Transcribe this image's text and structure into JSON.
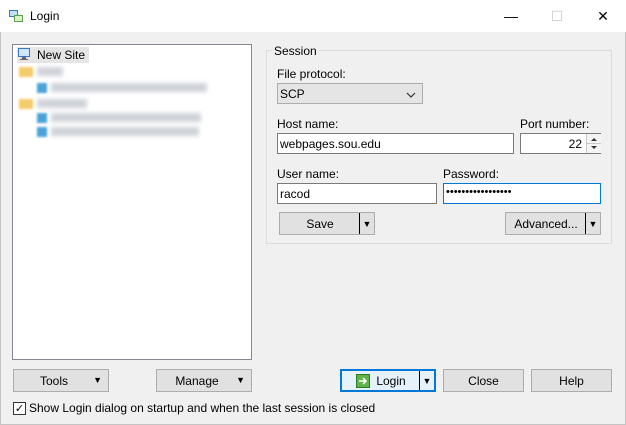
{
  "window": {
    "title": "Login",
    "minimize_glyph": "—",
    "maximize_glyph": "☐",
    "close_glyph": "✕"
  },
  "site_tree": {
    "selected_item": "New Site"
  },
  "session": {
    "group_title": "Session",
    "file_protocol_label": "File protocol:",
    "file_protocol_value": "SCP",
    "host_name_label": "Host name:",
    "host_name_value": "webpages.sou.edu",
    "port_number_label": "Port number:",
    "port_number_value": "22",
    "user_name_label": "User name:",
    "user_name_value": "racod",
    "password_label": "Password:",
    "password_value": "•••••••••••••••••",
    "save_label": "Save",
    "advanced_label": "Advanced..."
  },
  "bottom": {
    "tools_label": "Tools",
    "manage_label": "Manage",
    "login_label": "Login",
    "close_label": "Close",
    "help_label": "Help",
    "show_login_label": "Show Login dialog on startup and when the last session is closed",
    "show_login_checked": true
  },
  "colors": {
    "focus": "#0078d7",
    "folder": "#f3cb6b",
    "site_icon": "#4aa3d8"
  }
}
